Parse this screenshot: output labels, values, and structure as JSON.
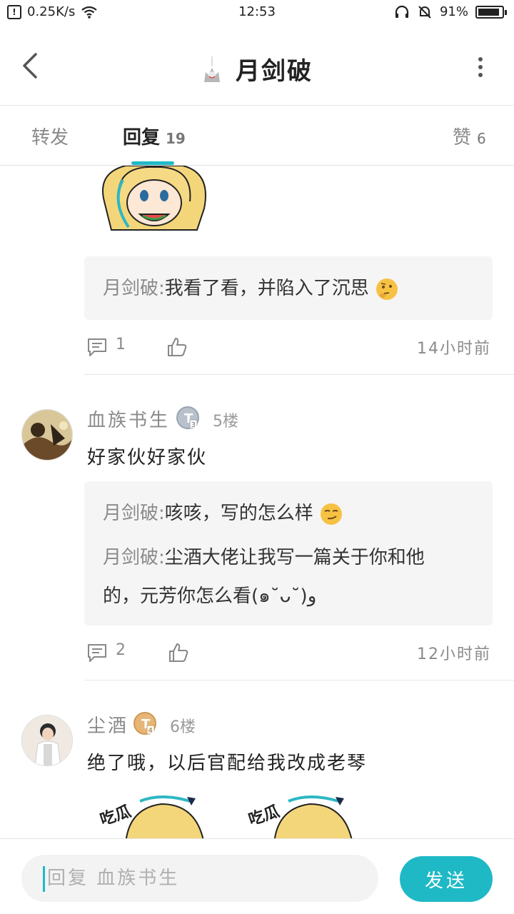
{
  "status_bar": {
    "net_speed": "0.25K/s",
    "time": "12:53",
    "battery": "91%",
    "battery_level": 0.91
  },
  "header": {
    "title": "月剑破"
  },
  "tabs": [
    {
      "label": "转发",
      "count": ""
    },
    {
      "label": "回复",
      "count": "19"
    },
    {
      "label": "赞",
      "count": "6"
    }
  ],
  "reply4": {
    "quotes": [
      {
        "name": "月剑破",
        "text": "我看了看，并陷入了沉思"
      }
    ],
    "comment_count": "1",
    "time": "14小时前",
    "emoji": "thinking-emoji"
  },
  "reply5": {
    "username": "血族书生",
    "badge": "T3",
    "floor": "5楼",
    "text": "好家伙好家伙",
    "quotes": [
      {
        "name": "月剑破",
        "text": "咳咳，写的怎么样"
      },
      {
        "name": "月剑破",
        "text": "尘酒大佬让我写一篇关于你和他",
        "cont": "的，元芳你怎么看(๑˘ᴗ˘)و"
      }
    ],
    "comment_count": "2",
    "time": "12小时前",
    "emoji": "smirk-emoji"
  },
  "reply6": {
    "username": "尘酒",
    "badge": "T4",
    "floor": "6楼",
    "text": "绝了哦，以后官配给我改成老琴",
    "sticker_text": "吃瓜"
  },
  "bottom": {
    "placeholder": "回复 血族书生",
    "send_label": "发送"
  },
  "colors": {
    "accent": "#1fb9c6",
    "badge_silver": "#b9c2cc",
    "badge_gold": "#e6b676"
  }
}
